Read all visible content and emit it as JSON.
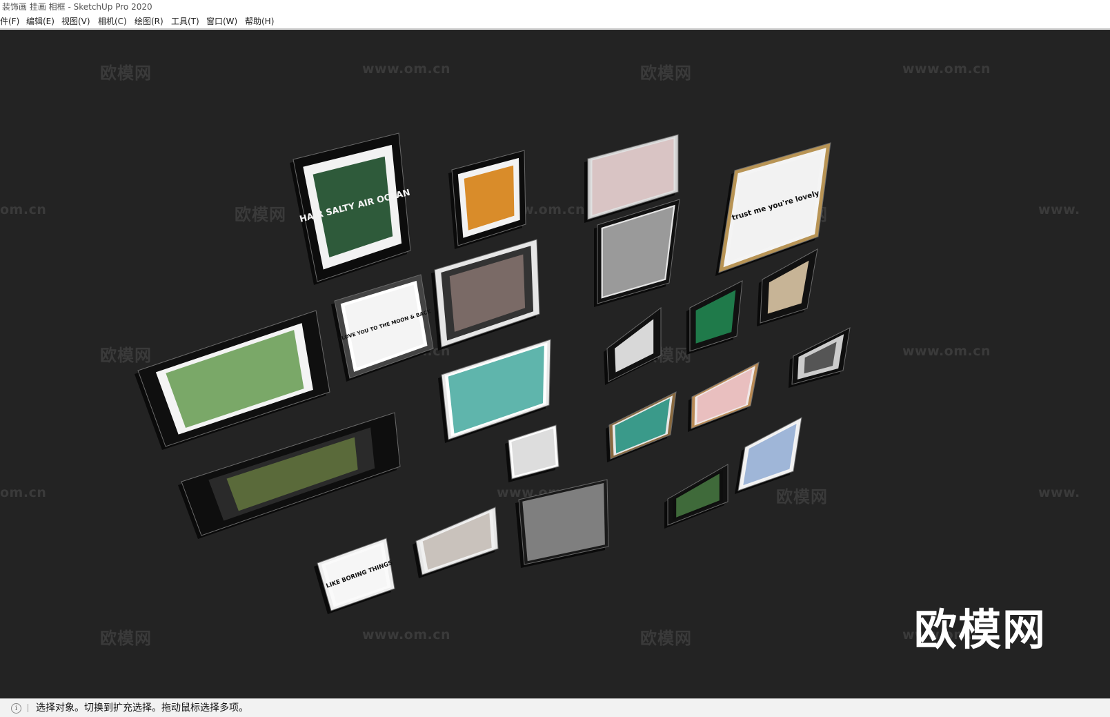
{
  "window": {
    "title": "装饰画 挂画 相框 - SketchUp Pro 2020"
  },
  "menu": [
    {
      "label": "件(F)"
    },
    {
      "label": "编辑(E)"
    },
    {
      "label": "视图(V)"
    },
    {
      "label": "相机(C)"
    },
    {
      "label": "绘图(R)"
    },
    {
      "label": "工具(T)"
    },
    {
      "label": "窗口(W)"
    },
    {
      "label": "帮助(H)"
    }
  ],
  "viewport": {
    "background": "#232323",
    "watermark_text": "欧模网",
    "watermark_url": "www.om.cn",
    "watermark_url_partial": "om.cn",
    "watermark_url_cut": "www.",
    "logo_text": "欧模网"
  },
  "artworks": [
    {
      "name": "frame-hair-salty-air-ocean",
      "text": "HAIR SALTY AIR OCEAN",
      "frame": "#0c0c0c",
      "art": "#2e5a3a"
    },
    {
      "name": "frame-orange-poster",
      "frame": "#0c0c0c",
      "art": "#d98c2a"
    },
    {
      "name": "frame-pink-abstract",
      "frame": "#cfcfcf",
      "art": "#d9c4c4"
    },
    {
      "name": "frame-trust-me-you-are-lovely",
      "text": "trust me you're lovely",
      "frame": "#b89455",
      "art": "#f2f2f2"
    },
    {
      "name": "frame-patterned",
      "frame": "#111111",
      "art": "#9a9a9a"
    },
    {
      "name": "frame-feet-beach",
      "frame": "#e6e6e6",
      "art": "#7a6a66"
    },
    {
      "name": "frame-i-love-you-to-the-moon-and-back",
      "text": "I LOVE YOU TO THE MOON & BACK",
      "frame": "#444444",
      "art": "#f4f4f4"
    },
    {
      "name": "frame-leaves-wide",
      "frame": "#0f0f0f",
      "art": "#7aa868"
    },
    {
      "name": "frame-green-script",
      "frame": "#111111",
      "art": "#1f7a4a"
    },
    {
      "name": "frame-wooden-room",
      "frame": "#111111",
      "art": "#c7b496"
    },
    {
      "name": "frame-palm-leaf-bw",
      "frame": "#111111",
      "art": "#d8d8d8"
    },
    {
      "name": "frame-beach-sea",
      "frame": "#e8e8e8",
      "art": "#5fb5ac"
    },
    {
      "name": "frame-small-gray",
      "frame": "#0e0e0e",
      "art": "#555555"
    },
    {
      "name": "frame-flamingo",
      "frame": "#b88a55",
      "art": "#e9bfbf"
    },
    {
      "name": "frame-teal-waves",
      "frame": "#8a6a40",
      "art": "#3a9a8a"
    },
    {
      "name": "frame-tropical-long",
      "frame": "#0e0e0e",
      "art": "#5a6a3a"
    },
    {
      "name": "frame-splash-bw",
      "frame": "#eeeeee",
      "art": "#dddddd"
    },
    {
      "name": "frame-hanging-bulbs",
      "frame": "#f0f0f0",
      "art": "#9fb6d8"
    },
    {
      "name": "frame-small-green",
      "frame": "#111111",
      "art": "#3f6a3a"
    },
    {
      "name": "frame-city-street",
      "frame": "#1a1a1a",
      "art": "#7f7f7f"
    },
    {
      "name": "frame-feather-sketch",
      "frame": "#e6e6e6",
      "art": "#c9c2bc"
    },
    {
      "name": "frame-i-like-boring-things",
      "text": "I LIKE BORING THINGS",
      "frame": "#eeeeee",
      "art": "#f6f6f6"
    }
  ],
  "status": {
    "text": "选择对象。切换到扩充选择。拖动鼠标选择多项。"
  }
}
